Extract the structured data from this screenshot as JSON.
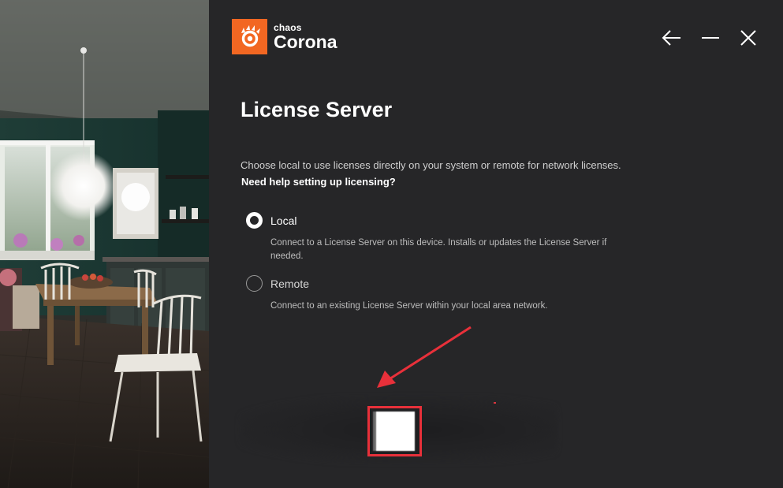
{
  "app": {
    "brand": "chaos",
    "product": "Corona"
  },
  "window_controls": {
    "back_icon": "arrow-left-icon",
    "minimize_icon": "minimize-icon",
    "close_icon": "close-icon"
  },
  "page": {
    "title": "License Server",
    "intro": "Choose local to use licenses directly on your system or remote for network licenses.",
    "help_link": "Need help setting up licensing?"
  },
  "options": [
    {
      "label": "Local",
      "description": "Connect to a License Server on this device. Installs or updates the License Server if needed.",
      "selected": true
    },
    {
      "label": "Remote",
      "description": "Connect to an existing License Server within your local area network.",
      "selected": false
    }
  ],
  "colors": {
    "accent": "#f26722",
    "panel_bg": "#262628",
    "annotation": "#e8303a"
  }
}
